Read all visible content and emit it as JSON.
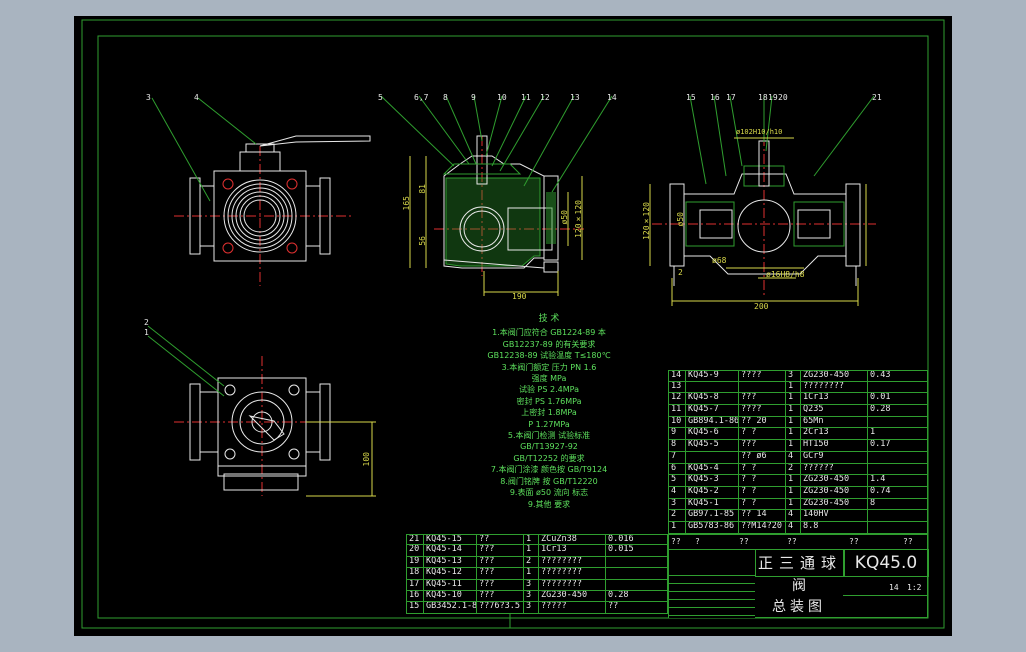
{
  "colors": {
    "background": "#a9b4c0",
    "sheet": "#000000",
    "frame": "#2f9e2f",
    "line": "#e8e8e8",
    "dim": "#d8d84a",
    "center": "#e03030",
    "notes": "#5de05d"
  },
  "title_block": {
    "name_left": "正三通球",
    "name_right": "阀",
    "drawing_no": "KQ45.0",
    "subtitle": "总装图",
    "scale": "1:2",
    "qty": "14"
  },
  "views": {
    "front": {
      "balloons": [
        "3",
        "4"
      ]
    },
    "section_a": {
      "balloons": [
        "5",
        "6,7",
        "8",
        "9",
        "10",
        "11",
        "12",
        "13",
        "14"
      ],
      "dims": {
        "height": "165",
        "top": "81",
        "bottom": "56",
        "width": "190",
        "bore": "ø50",
        "flange": "120×120"
      }
    },
    "section_b": {
      "balloons": [
        "15",
        "16",
        "17",
        "18",
        "19",
        "20",
        "21"
      ],
      "dims": {
        "stem": "ø102H10/h10",
        "bore": "ø50",
        "sq": "120×120",
        "width": "200",
        "d68": "ø68",
        "d16": "ø16H8/h8",
        "step": "2"
      }
    },
    "top": {
      "balloons": [
        "2",
        "1"
      ],
      "dims": {
        "height": "100"
      }
    }
  },
  "notes": {
    "heading": "技 术",
    "lines": [
      "1.本阀门应符合 GB1224-89 本",
      "GB12237-89 的有关要求",
      "GB12238-89 试验温度 T≤180℃",
      "3.本阀门额定 压力 PN 1.6",
      "强度 MPa",
      "试验 PS 2.4MPa",
      "密封 PS 1.76MPa",
      "上密封 1.8MPa",
      "P 1.27MPa",
      "5.本阀门检测 试验标准",
      "GB/T13927-92",
      "GB/T12252 的要求",
      "7.本阀门涂漆 颜色按 GB/T9124",
      "8.阀门铭牌 按 GB/T12220",
      "9.表面 ø50 流向 标志",
      "9.其他 要求"
    ]
  },
  "bom_upper": {
    "rows": [
      {
        "no": "14",
        "code": "KQ45-9",
        "name": "????",
        "qty": "3",
        "mat": "ZG230-450",
        "wt": "0.43"
      },
      {
        "no": "13",
        "code": "",
        "name": "",
        "qty": "1",
        "mat": "????????",
        "wt": ""
      },
      {
        "no": "12",
        "code": "KQ45-8",
        "name": "???",
        "qty": "1",
        "mat": "1Cr13",
        "wt": "0.01"
      },
      {
        "no": "11",
        "code": "KQ45-7",
        "name": "????",
        "qty": "1",
        "mat": "Q235",
        "wt": "0.28"
      },
      {
        "no": "10",
        "code": "GB894.1-86",
        "name": "?? 20",
        "qty": "1",
        "mat": "65Mn",
        "wt": ""
      },
      {
        "no": "9",
        "code": "KQ45-6",
        "name": "? ?",
        "qty": "1",
        "mat": "2Cr13",
        "wt": "1"
      },
      {
        "no": "8",
        "code": "KQ45-5",
        "name": "???",
        "qty": "1",
        "mat": "HT150",
        "wt": "0.17"
      },
      {
        "no": "7",
        "code": "",
        "name": "?? ø6",
        "qty": "4",
        "mat": "GCr9",
        "wt": ""
      },
      {
        "no": "6",
        "code": "KQ45-4",
        "name": "? ?",
        "qty": "2",
        "mat": "??????",
        "wt": ""
      },
      {
        "no": "5",
        "code": "KQ45-3",
        "name": "? ?",
        "qty": "1",
        "mat": "ZG230-450",
        "wt": "1.4"
      },
      {
        "no": "4",
        "code": "KQ45-2",
        "name": "? ?",
        "qty": "1",
        "mat": "ZG230-450",
        "wt": "0.74"
      },
      {
        "no": "3",
        "code": "KQ45-1",
        "name": "? ?",
        "qty": "1",
        "mat": "ZG230-450",
        "wt": "8"
      },
      {
        "no": "2",
        "code": "GB97.1-85",
        "name": "?? 14",
        "qty": "4",
        "mat": "140HV",
        "wt": ""
      },
      {
        "no": "1",
        "code": "GB5783-86",
        "name": "??M14?20",
        "qty": "4",
        "mat": "8.8",
        "wt": ""
      }
    ],
    "header": [
      "??",
      "?",
      "??",
      "??",
      "??",
      "??"
    ]
  },
  "bom_lower": {
    "rows": [
      {
        "no": "21",
        "code": "KQ45-15",
        "name": "??",
        "qty": "1",
        "mat": "ZCuZn38",
        "wt": "0.016"
      },
      {
        "no": "20",
        "code": "KQ45-14",
        "name": "???",
        "qty": "1",
        "mat": "1Cr13",
        "wt": "0.015"
      },
      {
        "no": "19",
        "code": "KQ45-13",
        "name": "???",
        "qty": "2",
        "mat": "????????",
        "wt": ""
      },
      {
        "no": "18",
        "code": "KQ45-12",
        "name": "???",
        "qty": "1",
        "mat": "????????",
        "wt": ""
      },
      {
        "no": "17",
        "code": "KQ45-11",
        "name": "???",
        "qty": "3",
        "mat": "????????",
        "wt": ""
      },
      {
        "no": "16",
        "code": "KQ45-10",
        "name": "???",
        "qty": "3",
        "mat": "ZG230-450",
        "wt": "0.28"
      },
      {
        "no": "15",
        "code": "GB3452.1-82",
        "name": "??76?3.5",
        "qty": "3",
        "mat": "?????",
        "wt": "??"
      }
    ]
  }
}
